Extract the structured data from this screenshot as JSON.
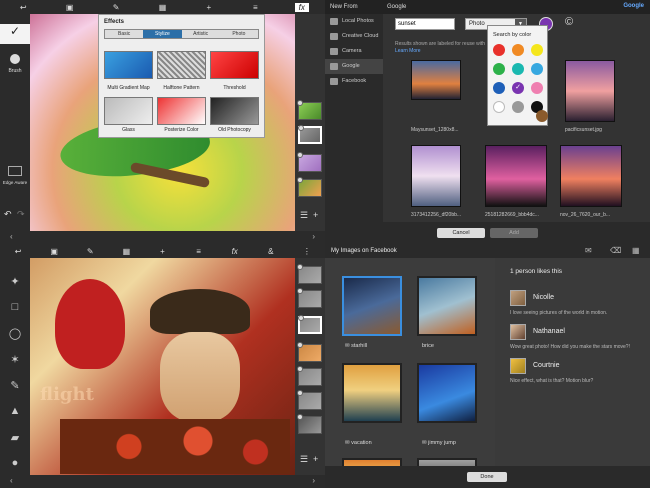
{
  "q1": {
    "toolbar_icons": [
      "back-icon",
      "image-icon",
      "brush-icon",
      "crop-icon",
      "plus-icon",
      "adjust-icon",
      "fx-icon"
    ],
    "brush_label": "Brush",
    "edge_label": "Edge Aware",
    "effects": {
      "title": "Effects",
      "tabs": [
        "Basic",
        "Stylize",
        "Artistic",
        "Photo"
      ],
      "active_tab": "Stylize",
      "items": [
        "Multi Gradient Map",
        "Halftone Pattern",
        "Threshold",
        "Glass",
        "Posterize Color",
        "Old Photocopy"
      ]
    }
  },
  "q2": {
    "title_left": "New From",
    "title_right": "Google",
    "brand": "Google",
    "sources": [
      "Local Photos",
      "Creative Cloud",
      "Camera",
      "Google",
      "Facebook"
    ],
    "active_source": "Google",
    "search_value": "sunset",
    "type_value": "Photo",
    "notice_text": "Results shown are labeled for reuse with",
    "notice_link": "Learn More",
    "picker_title": "Search by color",
    "swatches": [
      "#e8312b",
      "#f08a24",
      "#f5e61c",
      "#2db14a",
      "#1ab8b0",
      "#37a8e0",
      "#1e5fb8",
      "#7a34b0",
      "#ef7fb0",
      "#ffffff",
      "#999999",
      "#111111",
      "#8a5a2b"
    ],
    "selected_swatch": "#7a34b0",
    "thumb_captions": [
      "Maysunset_1280x8...",
      "",
      "pacificsunset.jpg",
      "3173412256_df20bb...",
      "25181282669_bbb4dc...",
      "nov_26_7620_our_b..."
    ],
    "cancel_label": "Cancel",
    "add_label": "Add"
  },
  "q3": {
    "toolbar_icons": [
      "back-icon",
      "image-icon",
      "brush-icon",
      "crop-icon",
      "plus-icon",
      "adjust-icon",
      "fx-icon",
      "share-icon",
      "more-icon"
    ],
    "tools": [
      "wand-icon",
      "rect-select-icon",
      "lasso-icon",
      "magic-icon",
      "brush-icon",
      "stamp-icon",
      "eraser-icon",
      "drop-icon"
    ],
    "caption_text": "flight"
  },
  "q4": {
    "title": "My Images on Facebook",
    "images": [
      {
        "caption": "starhill"
      },
      {
        "caption": "brice"
      },
      {
        "caption": "vacation"
      },
      {
        "caption": "jimmy jump"
      }
    ],
    "likes": "1 person likes this",
    "comments": [
      {
        "name": "Nicolle",
        "text": "I love seeing pictures of the world in motion."
      },
      {
        "name": "Nathanael",
        "text": "Wow great photo! How did you make the stars move?!"
      },
      {
        "name": "Courtnie",
        "text": "Nice effect, what is that? Motion blur?"
      }
    ],
    "done_label": "Done"
  }
}
